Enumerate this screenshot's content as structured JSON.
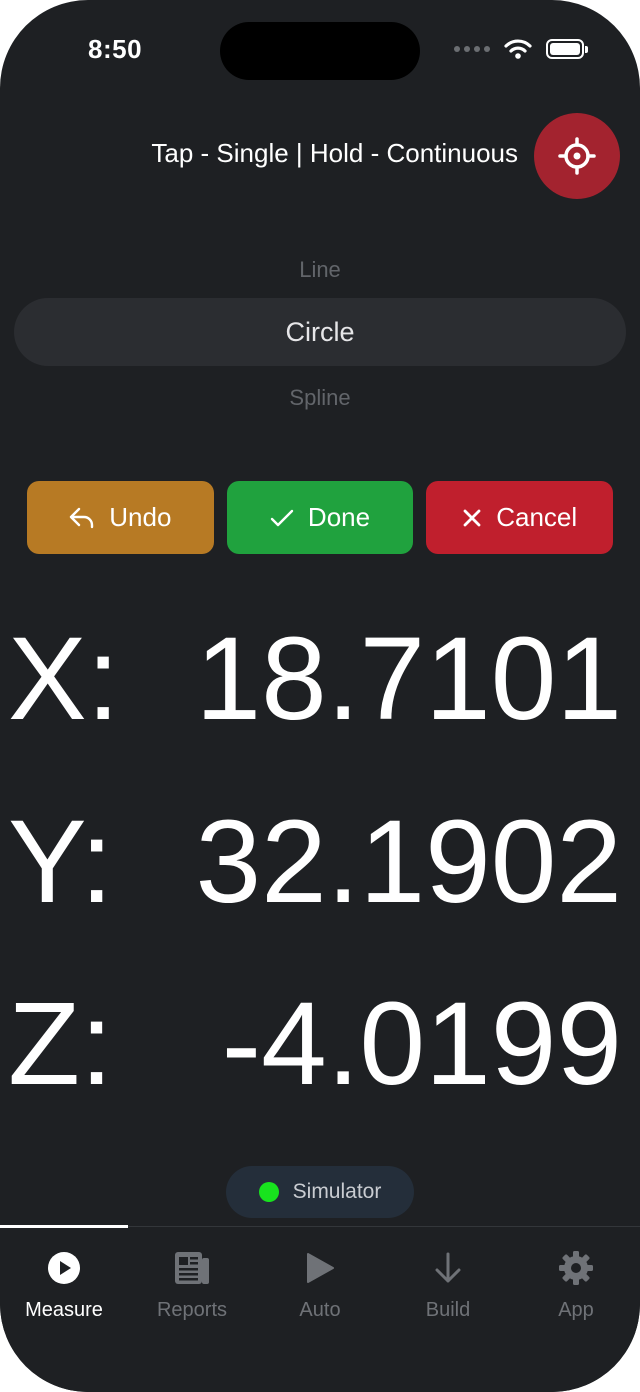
{
  "status_bar": {
    "time": "8:50"
  },
  "header": {
    "hint": "Tap - Single | Hold - Continuous",
    "target_icon": "crosshair-icon"
  },
  "picker": {
    "options": [
      "Line",
      "Circle",
      "Spline"
    ],
    "selected": "Circle"
  },
  "actions": {
    "undo": "Undo",
    "done": "Done",
    "cancel": "Cancel"
  },
  "coordinates": {
    "x": {
      "label": "X:",
      "value": "18.7101"
    },
    "y": {
      "label": "Y:",
      "value": "32.1902"
    },
    "z": {
      "label": "Z:",
      "value": "-4.0199"
    }
  },
  "connection": {
    "label": "Simulator",
    "status_color": "#18e31e"
  },
  "tabs": [
    {
      "label": "Measure",
      "icon": "play-circle-icon",
      "active": true
    },
    {
      "label": "Reports",
      "icon": "newspaper-icon",
      "active": false
    },
    {
      "label": "Auto",
      "icon": "play-icon",
      "active": false
    },
    {
      "label": "Build",
      "icon": "arrow-down-icon",
      "active": false
    },
    {
      "label": "App",
      "icon": "gear-icon",
      "active": false
    }
  ],
  "colors": {
    "undo": "#b77a24",
    "done": "#20a23e",
    "cancel": "#c01f2d",
    "target": "#a3232f"
  }
}
